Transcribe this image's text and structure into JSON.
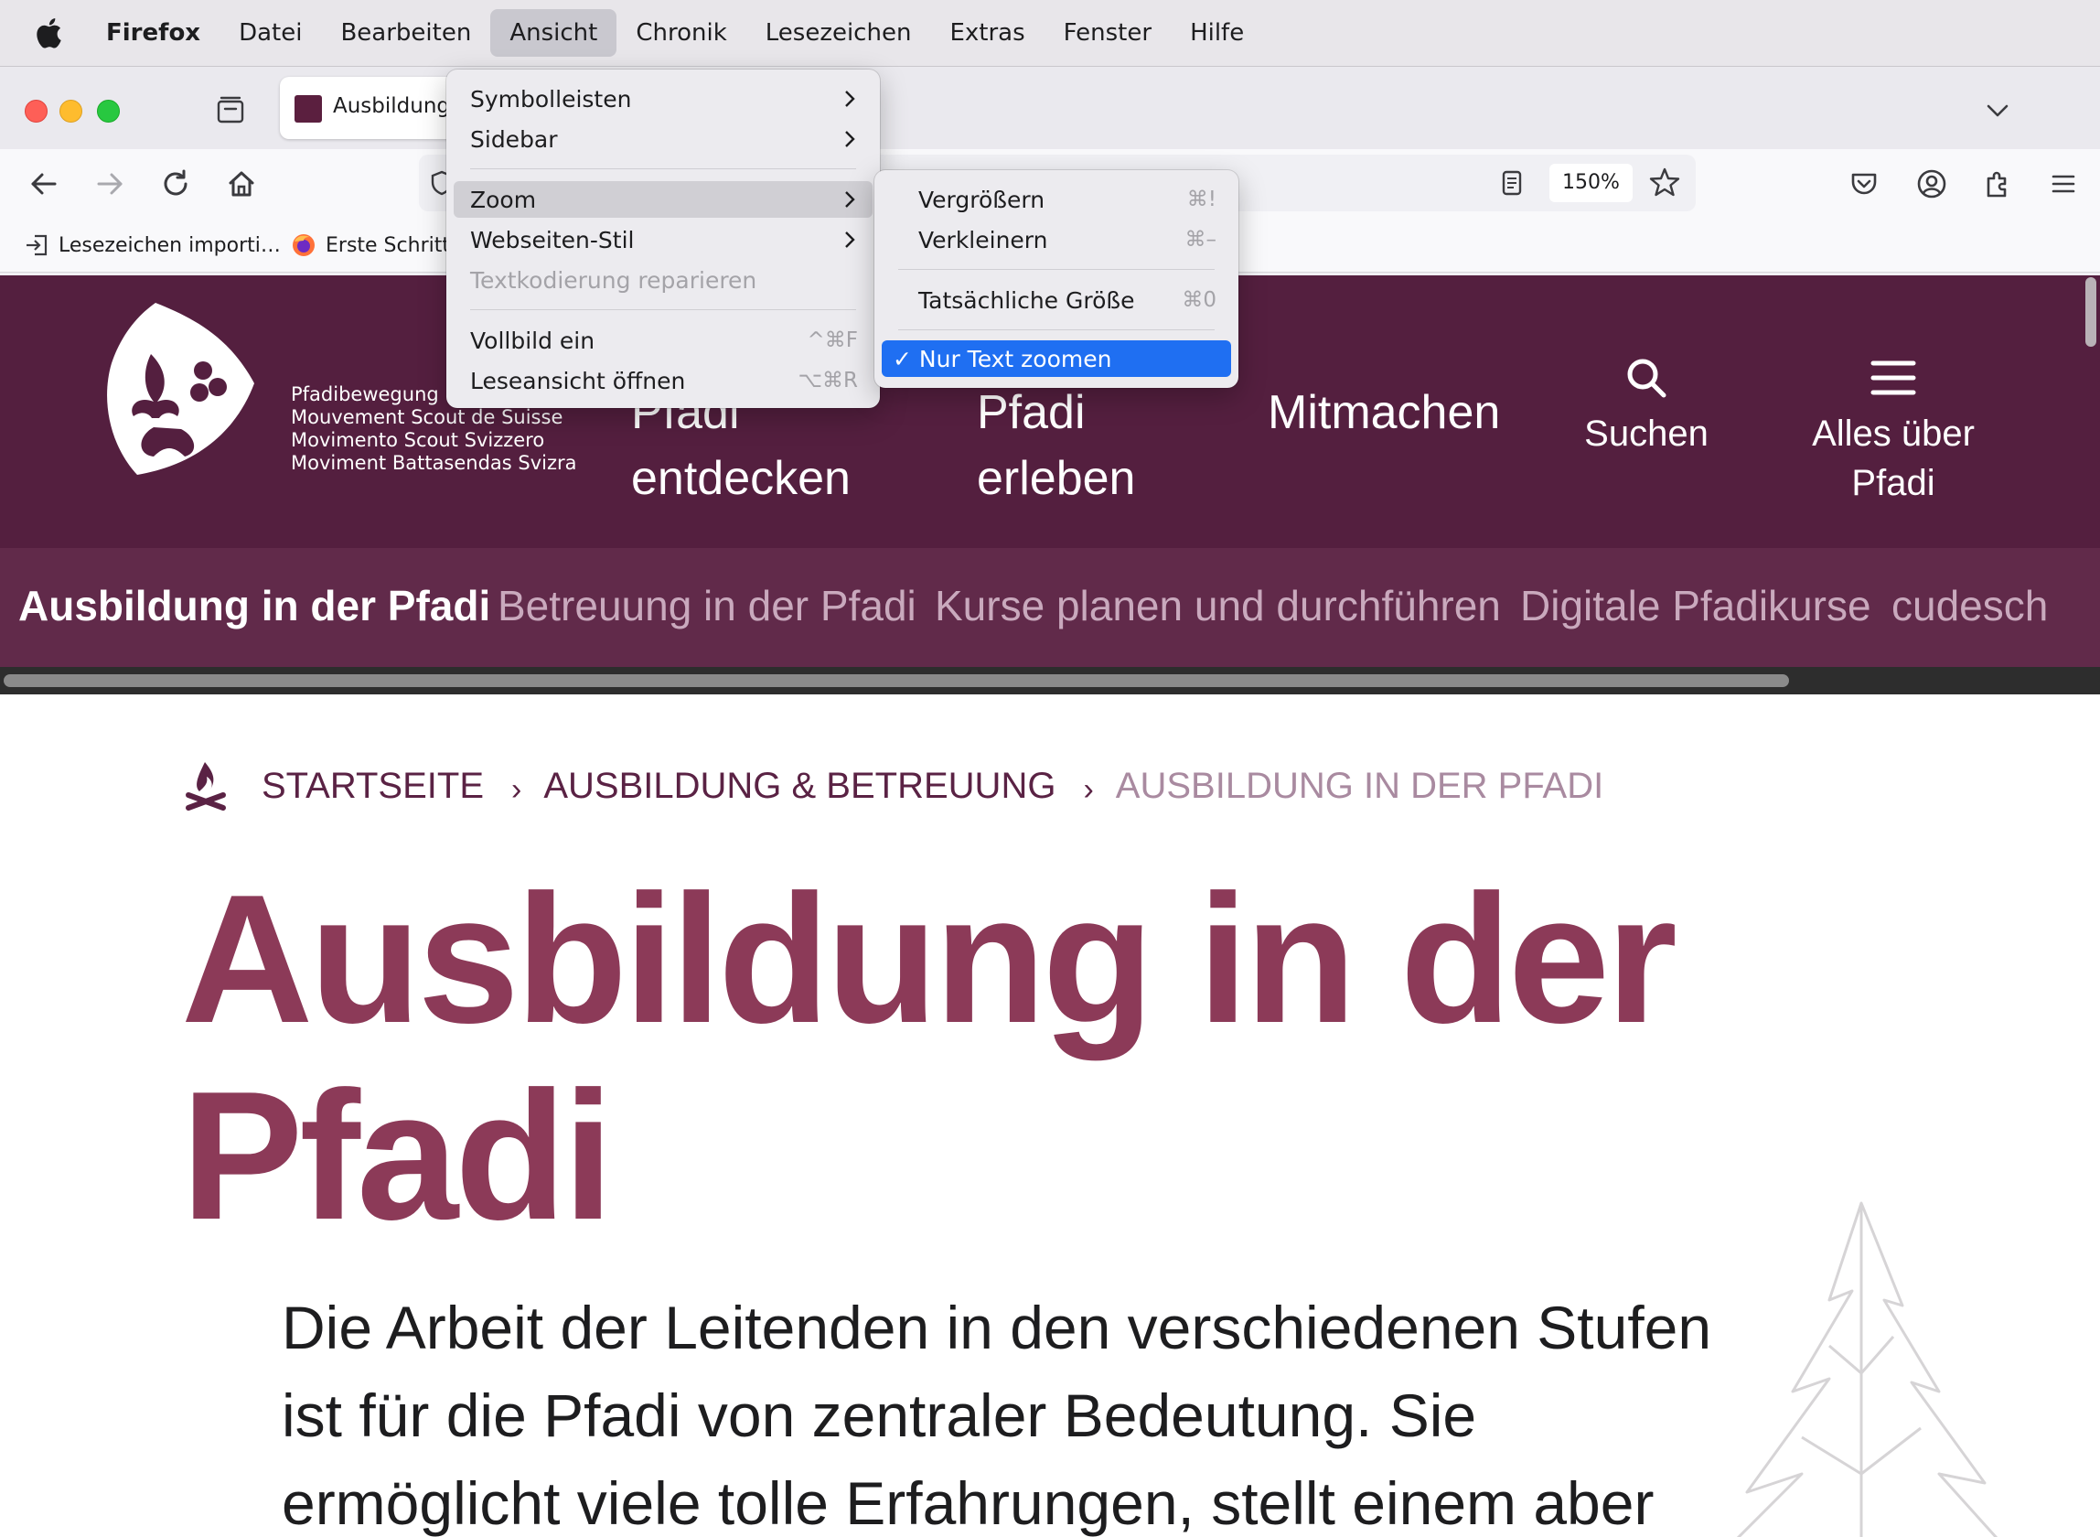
{
  "menubar": {
    "app": "Firefox",
    "items": [
      "Datei",
      "Bearbeiten",
      "Ansicht",
      "Chronik",
      "Lesezeichen",
      "Extras",
      "Fenster",
      "Hilfe"
    ],
    "active_index": 2
  },
  "tab": {
    "title": "Ausbildung"
  },
  "toolbar": {
    "zoom": "150%"
  },
  "bookmarks": [
    {
      "label": "Lesezeichen importi…",
      "icon": "import-icon"
    },
    {
      "label": "Erste Schritt",
      "icon": "firefox-icon"
    }
  ],
  "view_menu": {
    "items": [
      {
        "label": "Symbolleisten",
        "submenu": true
      },
      {
        "label": "Sidebar",
        "submenu": true
      },
      {
        "label": "Zoom",
        "submenu": true,
        "highlighted": true
      },
      {
        "label": "Webseiten-Stil",
        "submenu": true
      },
      {
        "label": "Textkodierung reparieren",
        "disabled": true
      },
      {
        "label": "Vollbild ein",
        "shortcut": "^⌘F"
      },
      {
        "label": "Leseansicht öffnen",
        "shortcut": "⌥⌘R"
      }
    ]
  },
  "zoom_menu": {
    "items": [
      {
        "label": "Vergrößern",
        "shortcut": "⌘!"
      },
      {
        "label": "Verkleinern",
        "shortcut": "⌘–"
      },
      {
        "label": "Tatsächliche Größe",
        "shortcut": "⌘0"
      },
      {
        "label": "✓ Nur Text zoomen",
        "checked": true
      }
    ]
  },
  "site": {
    "org_lines": [
      "Pfadibewegung",
      "Mouvement Scout de Suisse",
      "Movimento Scout Svizzero",
      "Moviment Battasendas Svizra"
    ],
    "mainnav": [
      {
        "line1": "Pfadi",
        "line2": "entdecken"
      },
      {
        "line1": "Pfadi",
        "line2": "erleben"
      },
      {
        "line1": "Mitmachen",
        "line2": ""
      }
    ],
    "search_label": "Suchen",
    "menu_label_1": "Alles über",
    "menu_label_2": "Pfadi",
    "subnav": [
      "Ausbildung in der Pfadi",
      "Betreuung in der Pfadi",
      "Kurse planen und durchführen",
      "Digitale Pfadikurse",
      "cudesch"
    ],
    "breadcrumb": [
      "STARTSEITE",
      "AUSBILDUNG & BETREUUNG",
      "AUSBILDUNG IN DER PFADI"
    ],
    "title_line1": "Ausbildung in der",
    "title_line2": "Pfadi",
    "lead_lines": [
      "Die Arbeit der Leitenden in den verschiedenen Stufen",
      "ist für die Pfadi von zentraler Bedeutung. Sie",
      "ermöglicht viele tolle Erfahrungen, stellt einem aber"
    ]
  },
  "colors": {
    "header": "#541f3f",
    "subnav": "#612a4a",
    "title": "#8c3a58",
    "menu_selected": "#1f6ff2"
  }
}
